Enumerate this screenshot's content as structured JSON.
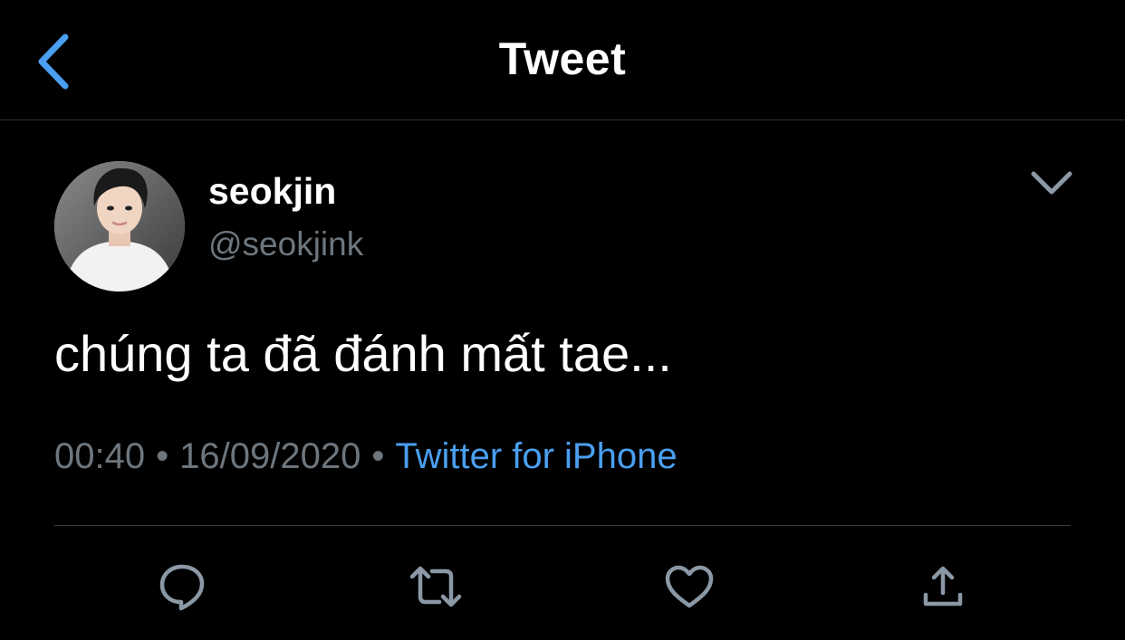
{
  "nav": {
    "title": "Tweet",
    "back_icon": "chevron-left-icon"
  },
  "tweet": {
    "author": {
      "display_name": "seokjin",
      "handle": "@seokjink"
    },
    "text": "chúng ta đã đánh mất tae...",
    "meta": {
      "time": "00:40",
      "separator": "•",
      "date": "16/09/2020",
      "source": "Twitter for iPhone"
    }
  },
  "actions": [
    {
      "name": "reply-icon"
    },
    {
      "name": "retweet-icon"
    },
    {
      "name": "like-icon"
    },
    {
      "name": "share-icon"
    }
  ],
  "colors": {
    "background": "#000000",
    "accent": "#4a9ff0",
    "secondary_text": "#6e767d",
    "icon": "#8b98a5"
  }
}
